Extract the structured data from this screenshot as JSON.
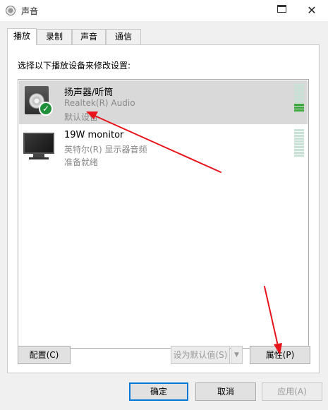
{
  "window": {
    "title": "声音",
    "help_icon": "help-icon",
    "close_glyph": "✕"
  },
  "tabs": [
    {
      "label": "播放",
      "active": true
    },
    {
      "label": "录制",
      "active": false
    },
    {
      "label": "声音",
      "active": false
    },
    {
      "label": "通信",
      "active": false
    }
  ],
  "panel": {
    "instruction": "选择以下播放设备来修改设置:"
  },
  "devices": [
    {
      "name": "扬声器/听筒",
      "driver": "Realtek(R) Audio",
      "status": "默认设备",
      "icon": "speaker-icon",
      "selected": true,
      "default": true
    },
    {
      "name": "19W monitor",
      "driver": "英特尔(R) 显示器音频",
      "status": "准备就绪",
      "icon": "monitor-icon",
      "selected": false,
      "default": false
    }
  ],
  "buttons": {
    "configure": "配置(C)",
    "set_default": "设为默认值(S)",
    "properties": "属性(P)",
    "ok": "确定",
    "cancel": "取消",
    "apply": "应用(A)"
  },
  "colors": {
    "annotation_arrow": "#e8141b",
    "meter_active": "#3caa3c",
    "selected_row": "#d9d9d9"
  }
}
